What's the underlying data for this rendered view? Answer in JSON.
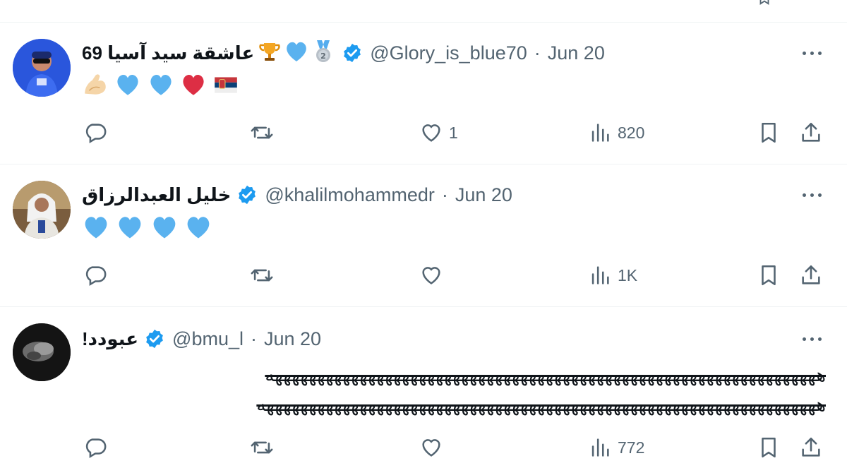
{
  "colors": {
    "text": "#0f1419",
    "muted": "#536471",
    "verified": "#1d9bf0",
    "heart_blue": "#5ab2ef",
    "divider": "#eff3f4"
  },
  "tweets": [
    {
      "display_name": "عاشقة سيد آسيا 69",
      "name_emoji": [
        "trophy",
        "blue-heart",
        "second-place-medal"
      ],
      "handle": "@Glory_is_blue70",
      "separator": "·",
      "date": "Jun 20",
      "body_emoji": [
        "flexed-biceps",
        "blue-heart",
        "blue-heart",
        "red-heart",
        "serbia-flag"
      ],
      "likes": "1",
      "views": "820"
    },
    {
      "display_name": "خليل العبدالرزاق",
      "handle": "@khalilmohammedr",
      "separator": "·",
      "date": "Jun 20",
      "body_emoji": [
        "blue-heart",
        "blue-heart",
        "blue-heart",
        "blue-heart"
      ],
      "likes": "",
      "views": "1K"
    },
    {
      "display_name": "عبودد!",
      "handle": "@bmu_l",
      "separator": "·",
      "date": "Jun 20",
      "body_text_line1": "هههههههههههههههههههههههههههههههههههههههههههههههههههههههههههههههههه",
      "body_text_line2": "ههههههههههههههههههههههههههههههههههههههههههههههههههههههههههههههههههه",
      "likes": "",
      "views": "772"
    }
  ]
}
